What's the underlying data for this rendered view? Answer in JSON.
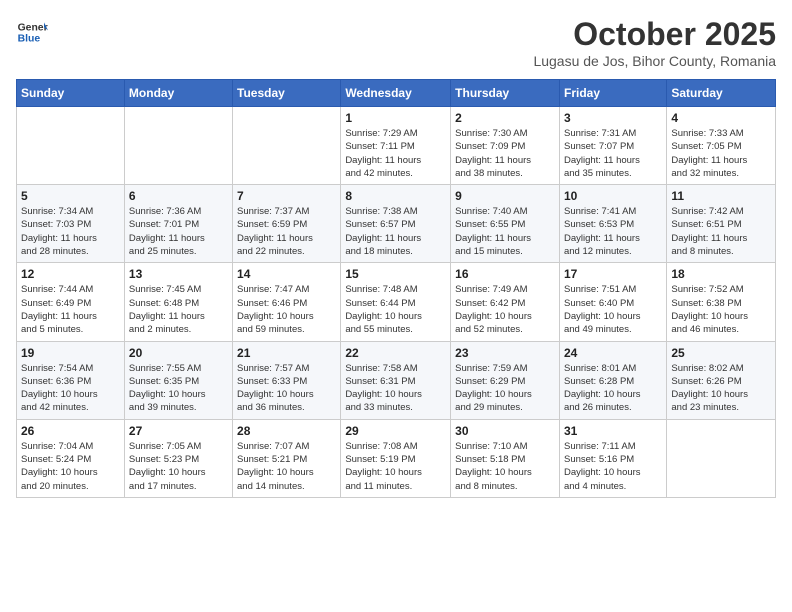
{
  "header": {
    "logo_general": "General",
    "logo_blue": "Blue",
    "title": "October 2025",
    "subtitle": "Lugasu de Jos, Bihor County, Romania"
  },
  "weekdays": [
    "Sunday",
    "Monday",
    "Tuesday",
    "Wednesday",
    "Thursday",
    "Friday",
    "Saturday"
  ],
  "weeks": [
    [
      {
        "day": "",
        "info": ""
      },
      {
        "day": "",
        "info": ""
      },
      {
        "day": "",
        "info": ""
      },
      {
        "day": "1",
        "info": "Sunrise: 7:29 AM\nSunset: 7:11 PM\nDaylight: 11 hours\nand 42 minutes."
      },
      {
        "day": "2",
        "info": "Sunrise: 7:30 AM\nSunset: 7:09 PM\nDaylight: 11 hours\nand 38 minutes."
      },
      {
        "day": "3",
        "info": "Sunrise: 7:31 AM\nSunset: 7:07 PM\nDaylight: 11 hours\nand 35 minutes."
      },
      {
        "day": "4",
        "info": "Sunrise: 7:33 AM\nSunset: 7:05 PM\nDaylight: 11 hours\nand 32 minutes."
      }
    ],
    [
      {
        "day": "5",
        "info": "Sunrise: 7:34 AM\nSunset: 7:03 PM\nDaylight: 11 hours\nand 28 minutes."
      },
      {
        "day": "6",
        "info": "Sunrise: 7:36 AM\nSunset: 7:01 PM\nDaylight: 11 hours\nand 25 minutes."
      },
      {
        "day": "7",
        "info": "Sunrise: 7:37 AM\nSunset: 6:59 PM\nDaylight: 11 hours\nand 22 minutes."
      },
      {
        "day": "8",
        "info": "Sunrise: 7:38 AM\nSunset: 6:57 PM\nDaylight: 11 hours\nand 18 minutes."
      },
      {
        "day": "9",
        "info": "Sunrise: 7:40 AM\nSunset: 6:55 PM\nDaylight: 11 hours\nand 15 minutes."
      },
      {
        "day": "10",
        "info": "Sunrise: 7:41 AM\nSunset: 6:53 PM\nDaylight: 11 hours\nand 12 minutes."
      },
      {
        "day": "11",
        "info": "Sunrise: 7:42 AM\nSunset: 6:51 PM\nDaylight: 11 hours\nand 8 minutes."
      }
    ],
    [
      {
        "day": "12",
        "info": "Sunrise: 7:44 AM\nSunset: 6:49 PM\nDaylight: 11 hours\nand 5 minutes."
      },
      {
        "day": "13",
        "info": "Sunrise: 7:45 AM\nSunset: 6:48 PM\nDaylight: 11 hours\nand 2 minutes."
      },
      {
        "day": "14",
        "info": "Sunrise: 7:47 AM\nSunset: 6:46 PM\nDaylight: 10 hours\nand 59 minutes."
      },
      {
        "day": "15",
        "info": "Sunrise: 7:48 AM\nSunset: 6:44 PM\nDaylight: 10 hours\nand 55 minutes."
      },
      {
        "day": "16",
        "info": "Sunrise: 7:49 AM\nSunset: 6:42 PM\nDaylight: 10 hours\nand 52 minutes."
      },
      {
        "day": "17",
        "info": "Sunrise: 7:51 AM\nSunset: 6:40 PM\nDaylight: 10 hours\nand 49 minutes."
      },
      {
        "day": "18",
        "info": "Sunrise: 7:52 AM\nSunset: 6:38 PM\nDaylight: 10 hours\nand 46 minutes."
      }
    ],
    [
      {
        "day": "19",
        "info": "Sunrise: 7:54 AM\nSunset: 6:36 PM\nDaylight: 10 hours\nand 42 minutes."
      },
      {
        "day": "20",
        "info": "Sunrise: 7:55 AM\nSunset: 6:35 PM\nDaylight: 10 hours\nand 39 minutes."
      },
      {
        "day": "21",
        "info": "Sunrise: 7:57 AM\nSunset: 6:33 PM\nDaylight: 10 hours\nand 36 minutes."
      },
      {
        "day": "22",
        "info": "Sunrise: 7:58 AM\nSunset: 6:31 PM\nDaylight: 10 hours\nand 33 minutes."
      },
      {
        "day": "23",
        "info": "Sunrise: 7:59 AM\nSunset: 6:29 PM\nDaylight: 10 hours\nand 29 minutes."
      },
      {
        "day": "24",
        "info": "Sunrise: 8:01 AM\nSunset: 6:28 PM\nDaylight: 10 hours\nand 26 minutes."
      },
      {
        "day": "25",
        "info": "Sunrise: 8:02 AM\nSunset: 6:26 PM\nDaylight: 10 hours\nand 23 minutes."
      }
    ],
    [
      {
        "day": "26",
        "info": "Sunrise: 7:04 AM\nSunset: 5:24 PM\nDaylight: 10 hours\nand 20 minutes."
      },
      {
        "day": "27",
        "info": "Sunrise: 7:05 AM\nSunset: 5:23 PM\nDaylight: 10 hours\nand 17 minutes."
      },
      {
        "day": "28",
        "info": "Sunrise: 7:07 AM\nSunset: 5:21 PM\nDaylight: 10 hours\nand 14 minutes."
      },
      {
        "day": "29",
        "info": "Sunrise: 7:08 AM\nSunset: 5:19 PM\nDaylight: 10 hours\nand 11 minutes."
      },
      {
        "day": "30",
        "info": "Sunrise: 7:10 AM\nSunset: 5:18 PM\nDaylight: 10 hours\nand 8 minutes."
      },
      {
        "day": "31",
        "info": "Sunrise: 7:11 AM\nSunset: 5:16 PM\nDaylight: 10 hours\nand 4 minutes."
      },
      {
        "day": "",
        "info": ""
      }
    ]
  ]
}
